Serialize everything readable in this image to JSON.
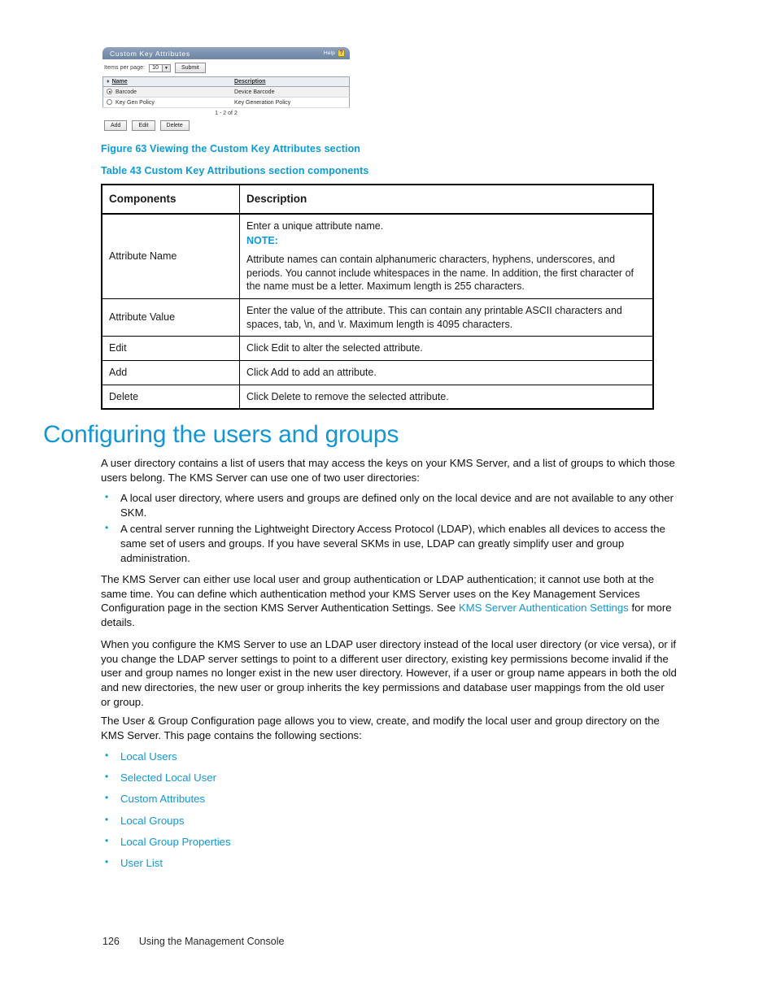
{
  "figure_screenshot": {
    "panel_title": "Custom Key Attributes",
    "help_label": "Help",
    "help_icon_glyph": "?",
    "items_per_page_label": "Items per page:",
    "items_per_page_value": "10",
    "submit_label": "Submit",
    "columns": [
      "Name",
      "Description"
    ],
    "sort_arrow_glyph": "♦",
    "rows": [
      {
        "selected": true,
        "name": "Barcode",
        "description": "Device Barcode"
      },
      {
        "selected": false,
        "name": "Key Gen Policy",
        "description": "Key Generation Policy"
      }
    ],
    "pager_text": "1 - 2 of 2",
    "buttons": [
      "Add",
      "Edit",
      "Delete"
    ],
    "titlebar_color": "#7a90ac",
    "help_icon_color": "#f4d73a"
  },
  "figure_caption": "Figure 63 Viewing the Custom Key Attributes section",
  "table_caption": "Table 43 Custom Key Attributions section components",
  "ref_table": {
    "headers": [
      "Components",
      "Description"
    ],
    "rows": [
      {
        "component": "Attribute Name",
        "description_line1": "Enter a unique attribute name.",
        "note_label": "NOTE:",
        "note_body": "Attribute names can contain alphanumeric characters, hyphens, underscores, and periods. You cannot include whitespaces in the name. In addition, the first character of the name must be a letter. Maximum length is 255 characters."
      },
      {
        "component": "Attribute Value",
        "description": "Enter the value of the attribute. This can contain any printable ASCII characters and spaces, tab, \\n, and \\r. Maximum length is 4095 characters."
      },
      {
        "component": "Edit",
        "description": "Click Edit to alter the selected attribute."
      },
      {
        "component": "Add",
        "description": "Click Add to add an attribute."
      },
      {
        "component": "Delete",
        "description": "Click Delete to remove the selected attribute."
      }
    ]
  },
  "section": {
    "heading": "Configuring the users and groups",
    "intro": "A user directory contains a list of users that may access the keys on your KMS Server, and a list of groups to which those users belong.  The KMS Server can use one of two user directories:",
    "directory_bullets": [
      "A local user directory, where users and groups are defined only on the local device and are not available to any other SKM.",
      "A central server running the Lightweight Directory Access Protocol (LDAP), which enables all devices to access the same set of users and groups.  If you have several SKMs in use, LDAP can greatly simplify user and group administration."
    ],
    "auth_paragraph_pre": "The KMS Server can either use local user and group authentication or LDAP authentication; it cannot use both at the same time.  You can define which authentication method your KMS Server uses on the Key Management Services Configuration page in the section KMS Server Authentication Settings.  See ",
    "auth_paragraph_link": "KMS Server Authentication Settings",
    "auth_paragraph_post": " for more details.",
    "ldap_paragraph": "When you configure the KMS Server to use an LDAP user directory instead of the local user directory (or vice versa), or if you change the LDAP server settings to point to a different user directory, existing key permissions become invalid if the user and group names no longer exist in the new user directory.  However, if a user or group name appears in both the old and new directories, the new user or group inherits the key permissions and database user mappings from the old user or group.",
    "usergroup_paragraph": "The User & Group Configuration page allows you to view, create, and modify the local user and group directory on the KMS Server.  This page contains the following sections:",
    "section_links": [
      "Local Users",
      "Selected Local User",
      "Custom Attributes",
      "Local Groups",
      "Local Group Properties",
      "User List"
    ]
  },
  "footer": {
    "page_number": "126",
    "chapter_title": "Using the Management Console"
  },
  "colors": {
    "accent_blue": "#1296d4",
    "caption_blue": "#0c9ad8",
    "link_blue": "#1296d4"
  }
}
